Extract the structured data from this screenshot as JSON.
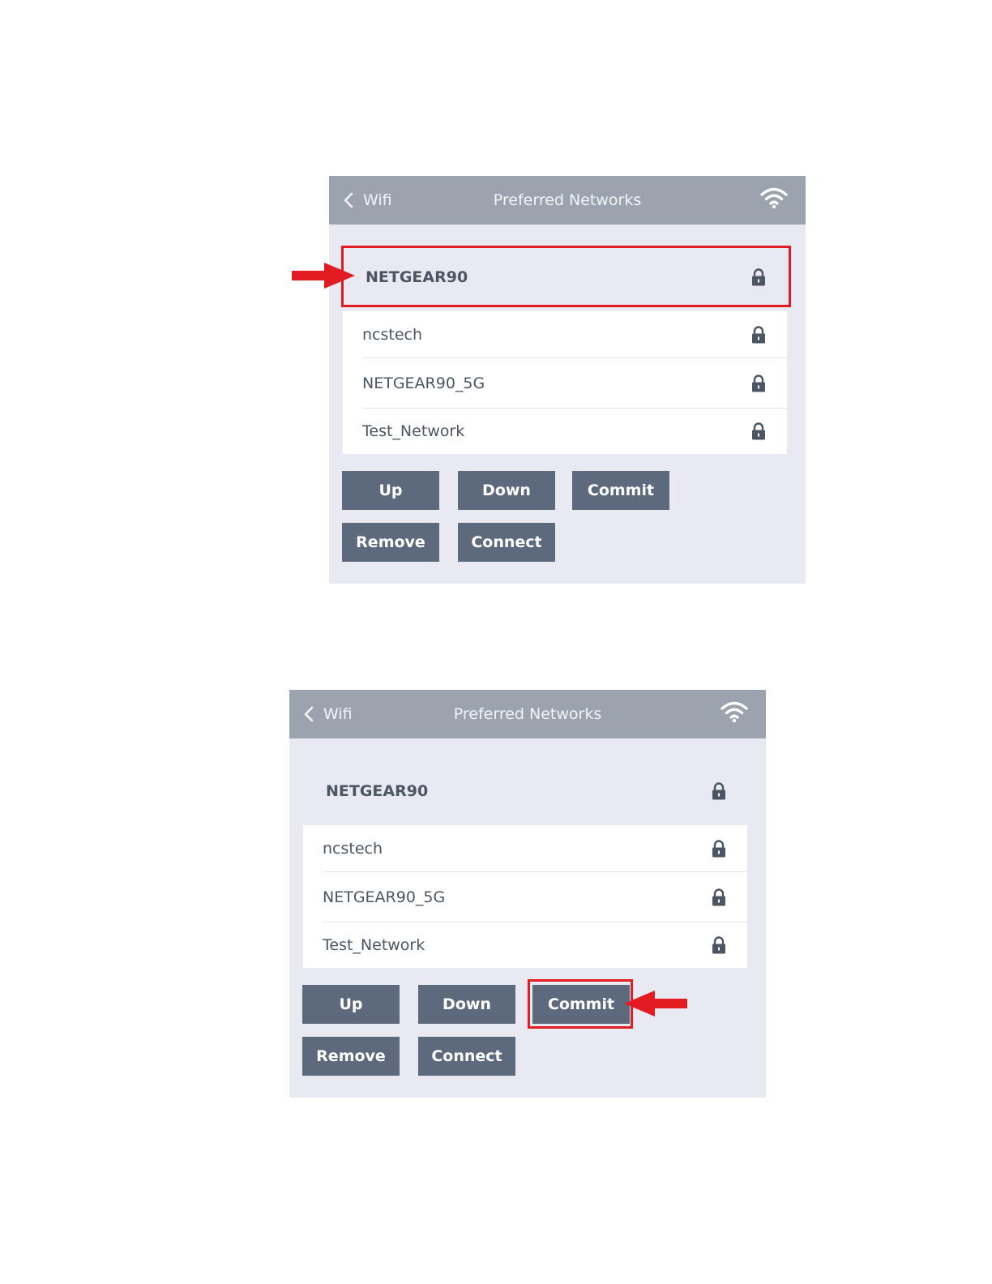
{
  "colors": {
    "header_bg": "#9aa3ae",
    "panel_bg": "#e8e9f1",
    "button_bg": "#5d6a7d",
    "highlight": "#e31b23"
  },
  "screens": [
    {
      "header": {
        "back_label": "Wifi",
        "title": "Preferred Networks",
        "status_icon": "wifi-icon"
      },
      "networks": [
        {
          "name": "NETGEAR90",
          "icon": "lock-icon",
          "selected": true
        },
        {
          "name": "ncstech",
          "icon": "lock-icon"
        },
        {
          "name": "NETGEAR90_5G",
          "icon": "lock-icon"
        },
        {
          "name": "Test_Network",
          "icon": "lock-icon"
        }
      ],
      "buttons": {
        "up": "Up",
        "down": "Down",
        "commit": "Commit",
        "remove": "Remove",
        "connect": "Connect"
      },
      "annotation": {
        "highlighted": "NETGEAR90 row",
        "arrow_icon": "arrow-right-icon"
      }
    },
    {
      "header": {
        "back_label": "Wifi",
        "title": "Preferred Networks",
        "status_icon": "wifi-icon"
      },
      "networks": [
        {
          "name": "NETGEAR90",
          "icon": "lock-icon",
          "selected": true
        },
        {
          "name": "ncstech",
          "icon": "lock-icon"
        },
        {
          "name": "NETGEAR90_5G",
          "icon": "lock-icon"
        },
        {
          "name": "Test_Network",
          "icon": "lock-icon"
        }
      ],
      "buttons": {
        "up": "Up",
        "down": "Down",
        "commit": "Commit",
        "remove": "Remove",
        "connect": "Connect"
      },
      "annotation": {
        "highlighted": "Commit button",
        "arrow_icon": "arrow-left-icon"
      }
    }
  ]
}
